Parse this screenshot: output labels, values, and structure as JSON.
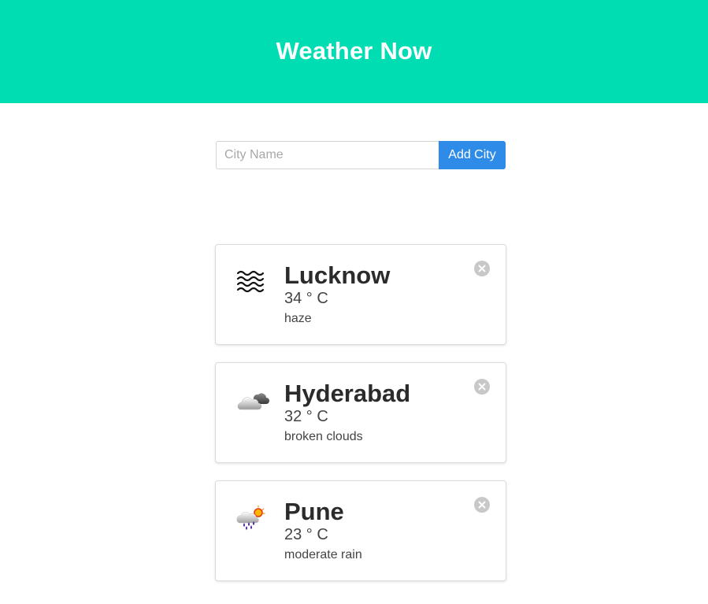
{
  "header": {
    "title": "Weather Now"
  },
  "search": {
    "placeholder": "City Name",
    "value": "",
    "button_label": "Add City"
  },
  "cards": [
    {
      "city": "Lucknow",
      "temp": "34 ° C",
      "description": "haze",
      "icon": "haze-icon"
    },
    {
      "city": "Hyderabad",
      "temp": "32 ° C",
      "description": "broken clouds",
      "icon": "broken-clouds-icon"
    },
    {
      "city": "Pune",
      "temp": "23 ° C",
      "description": "moderate rain",
      "icon": "moderate-rain-icon"
    }
  ],
  "colors": {
    "header_bg": "#00ddb3",
    "button_bg": "#2f8be8",
    "close_bg": "#c8c8c8"
  }
}
